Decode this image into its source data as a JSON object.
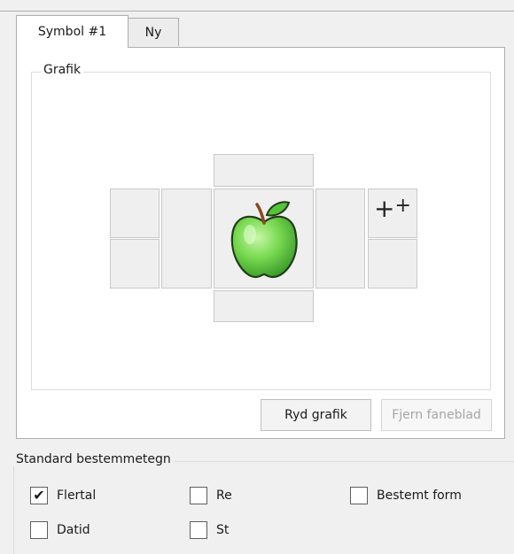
{
  "tabs": [
    {
      "label": "Symbol #1",
      "active": true
    },
    {
      "label": "Ny",
      "active": false
    }
  ],
  "grafik": {
    "title": "Grafik",
    "center_image": "green-apple",
    "add_button_icon": "add-plus-icon"
  },
  "buttons": {
    "clear": "Ryd grafik",
    "remove_tab": "Fjern faneblad"
  },
  "standard": {
    "title": "Standard bestemmetegn",
    "checkboxes": [
      {
        "label": "Flertal",
        "checked": true
      },
      {
        "label": "Re",
        "checked": false
      },
      {
        "label": "Bestemt form",
        "checked": false
      },
      {
        "label": "Datid",
        "checked": false
      },
      {
        "label": "St",
        "checked": false
      }
    ]
  },
  "colors": {
    "pane_bg": "#ffffff",
    "window_bg": "#f0f0f0",
    "cell_bg": "#efefef",
    "apple_green": "#6fcf4f"
  }
}
